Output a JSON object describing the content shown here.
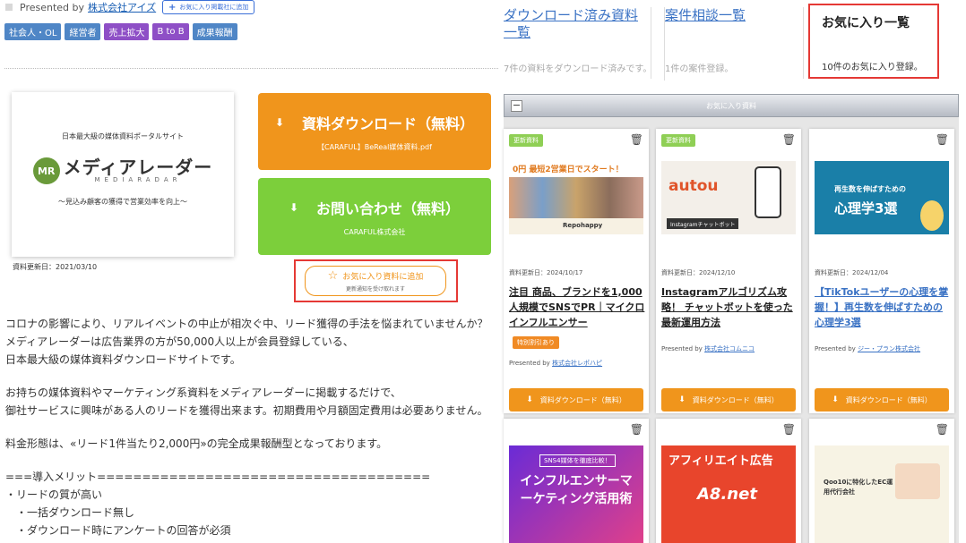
{
  "left": {
    "presented_prefix": "Presented by",
    "company_link": "株式会社アイズ",
    "add_company_label": "お気に入り掲載社に追加",
    "tags": [
      {
        "label": "社会人・OL",
        "color": "#4f86c6"
      },
      {
        "label": "経営者",
        "color": "#4f86c6"
      },
      {
        "label": "売上拡大",
        "color": "#8e4fc6"
      },
      {
        "label": "B to B",
        "color": "#8e4fc6"
      },
      {
        "label": "成果報酬",
        "color": "#4f86c6"
      }
    ],
    "doc_card": {
      "line1": "日本最大級の媒体資料ポータルサイト",
      "logo_mark": "MR",
      "logo_jp": "メディアレーダー",
      "logo_en": "MEDIARADAR",
      "tagline": "〜見込み顧客の獲得で営業効率を向上〜"
    },
    "updated": "資料更新日：2021/03/10",
    "download_button": {
      "label": "資料ダウンロード（無料）",
      "sub": "【CARAFUL】BeReal媒体資料.pdf"
    },
    "contact_button": {
      "label": "お問い合わせ（無料）",
      "sub": "CARAFUL株式会社"
    },
    "favorite_button": {
      "label": "お気に入り資料に追加",
      "note": "更新通知を受け取れます"
    },
    "description": [
      "コロナの影響により、リアルイベントの中止が相次ぐ中、リード獲得の手法を悩まれていませんか？",
      "メディアレーダーは広告業界の方が50,000人以上が会員登録している、",
      "日本最大級の媒体資料ダウンロードサイトです。",
      "",
      "お持ちの媒体資料やマーケティング系資料をメディアレーダーに掲載するだけで、",
      "御社サービスに興味がある人のリードを獲得出来ます。初期費用や月額固定費用は必要ありません。",
      "",
      "料金形態は、«リード1件当たり2,000円»の完全成果報酬型となっております。",
      "",
      "===導入メリット=====================================",
      "・リードの質が高い",
      "　・一括ダウンロード無し",
      "　・ダウンロード時にアンケートの回答が必須"
    ]
  },
  "right": {
    "tabs": [
      {
        "title": "ダウンロード済み資料一覧",
        "sub": "7件の資料をダウンロード済みです。"
      },
      {
        "title": "案件相談一覧",
        "sub": "1件の案件登録。"
      },
      {
        "title": "お気に入り一覧",
        "sub": "10件のお気に入り登録。"
      }
    ],
    "favorites_bar_label": "お気に入り資料",
    "collapse_symbol": "−",
    "card_badge": "更新資料",
    "download_label": "資料ダウンロード（無料）",
    "presented_prefix": "Presented by",
    "cards": [
      {
        "date": "資料更新日：2024/10/17",
        "title": "注目 商品、ブランドを1,000人規模でSNSでPR｜マイクロインフルエンサー",
        "limited": "特別割引あり",
        "company": "株式会社レポハピ",
        "thumb_text": "0円 最短2営業日でスタート！",
        "thumb_sub": "Repohappy"
      },
      {
        "date": "資料更新日：2024/12/10",
        "title": "Instagramアルゴリズム攻略！ チャットボットを使った最新運用方法",
        "company": "株式会社コムニコ",
        "thumb_text": "autou",
        "thumb_sub": "Instagramチャットボット"
      },
      {
        "date": "資料更新日：2024/12/04",
        "title": "【TikTokユーザーの心理を掌握！】再生数を伸ばすための心理学3選",
        "company": "ジー・プラン株式会社",
        "thumb_text": "再生数を伸ばすための",
        "thumb_sub": "心理学3選"
      },
      {
        "thumb_text": "インフルエンサーマーケティング活用術",
        "thumb_sub": "SNS4媒体を徹底比較！"
      },
      {
        "thumb_text": "アフィリエイト広告",
        "thumb_sub": "A8.net"
      },
      {
        "thumb_text": "Qoo10に特化したEC運用代行会社",
        "thumb_sub": ""
      }
    ]
  }
}
